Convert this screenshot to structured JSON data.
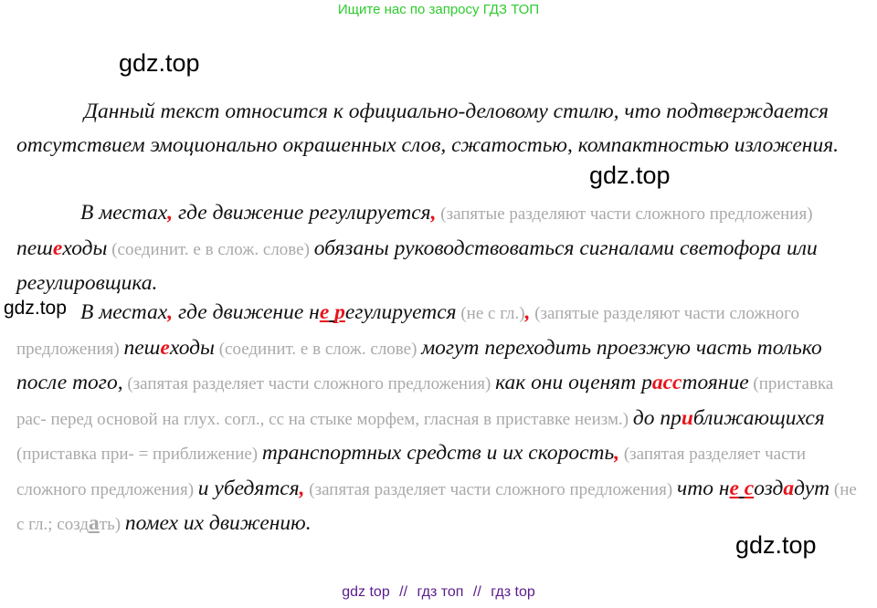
{
  "header": {
    "banner": "Ищите нас по запросу ГДЗ ТОП"
  },
  "watermarks": [
    "gdz.top",
    "gdz.top",
    "gdz.top",
    "gdz.top"
  ],
  "colors": {
    "banner": "#2ecc2e",
    "highlight": "#e8141b",
    "comment": "#a9a9a9",
    "footer": "#5a1b8c"
  },
  "intro": {
    "text": "Данный текст относится к официально-деловому стилю, что подтверждается отсутствием эмоционально окрашенных слов, сжатостью, компактностью изложения."
  },
  "sentence1": {
    "s1": "В местах",
    "s2": ",",
    "s3": " где движение регулируется",
    "s4": ",",
    "c1": " (запятые разделяют части сложного предложения) ",
    "s5": "пеш",
    "s6": "е",
    "s7": "ходы",
    "c2": " (соединит. е в слож. слове) ",
    "s8": "обязаны руководствоваться сигналами светофора или регулировщика."
  },
  "sentence2": {
    "s1": "В местах",
    "s2": ",",
    "s3": " где движение н",
    "s4": "е",
    "s5": " ",
    "s6": "р",
    "s7": "егулируется",
    "c1": " (не с гл.)",
    "s8": ",",
    "c2": " (запятые разделяют части сложного предложения) ",
    "s9": "пеш",
    "s10": "е",
    "s11": "ходы",
    "c3": " (соединит. е в слож. слове) ",
    "s12": "могут переходить проезжую часть только после того,",
    "c4": " (запятая разделяет части сложного предложения) ",
    "s13": "как они оценят р",
    "s14": "асс",
    "s15": "тояние",
    "c5": " (приставка рас- перед основой на глух. согл., сс на стыке морфем, гласная в приставке неизм.) ",
    "s16": "до пр",
    "s17": "и",
    "s18": "ближающихся",
    "c6": " (приставка при- = приближение) ",
    "s19": "транспортных средств и их скорость",
    "s20": ",",
    "c7": " (запятая разделяет части сложного предложения) ",
    "s21": "и убедятся",
    "s22": ",",
    "c8": " (запятая разделяет части сложного предложения) ",
    "s23": "что н",
    "s24": "е",
    "s25": " ",
    "s26": "с",
    "s27": "озд",
    "s28": "а",
    "s29": "дут",
    "c9a": " (не с гл.; созд",
    "c9b": "а",
    "c9c": "ть) ",
    "s30": "помех их движению."
  },
  "footer": {
    "link1": "gdz top",
    "sep1": "//",
    "link2": "гдз топ",
    "sep2": "//",
    "link3": "гдз top"
  }
}
